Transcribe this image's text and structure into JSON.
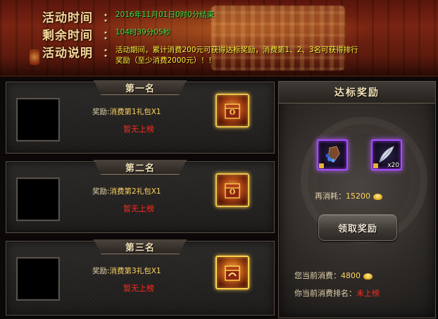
{
  "header": {
    "time_label": "活动时间",
    "time_value": "2016年11月01日0时0分结束",
    "remaining_label": "剩余时间",
    "remaining_value": "104时39分05秒",
    "desc_label": "活动说明",
    "desc_line1": "活动期间，累计消费200元可获得达标奖励，消费第1、2、3名可获得排行",
    "desc_line2": "奖励（至少消费2000元）！！",
    "colon": "："
  },
  "ranks": [
    {
      "title": "第一名",
      "reward_label": "奖励:",
      "reward_value": "消费第1礼包X1",
      "status": "暂无上榜",
      "icon": "chest-icon"
    },
    {
      "title": "第二名",
      "reward_label": "奖励:",
      "reward_value": "消费第2礼包X1",
      "status": "暂无上榜",
      "icon": "chest-icon"
    },
    {
      "title": "第三名",
      "reward_label": "奖励:",
      "reward_value": "消费第3礼包X1",
      "status": "暂无上榜",
      "icon": "chest-icon"
    }
  ],
  "target_reward": {
    "title": "达标奖励",
    "items": [
      {
        "icon": "gem-pouch-icon",
        "quantity": ""
      },
      {
        "icon": "feather-icon",
        "quantity": "x20"
      }
    ],
    "cost_label": "再消耗：",
    "cost_value": "15200",
    "claim_button": "领取奖励",
    "current_spend_label": "您当前消费：",
    "current_spend_value": "4800",
    "current_rank_label": "你当前消费排名：",
    "current_rank_value": "未上榜"
  },
  "colors": {
    "green": "#3fe04a",
    "yellow": "#fff23a",
    "red": "#ff2a1c",
    "gold": "#ffd460"
  }
}
